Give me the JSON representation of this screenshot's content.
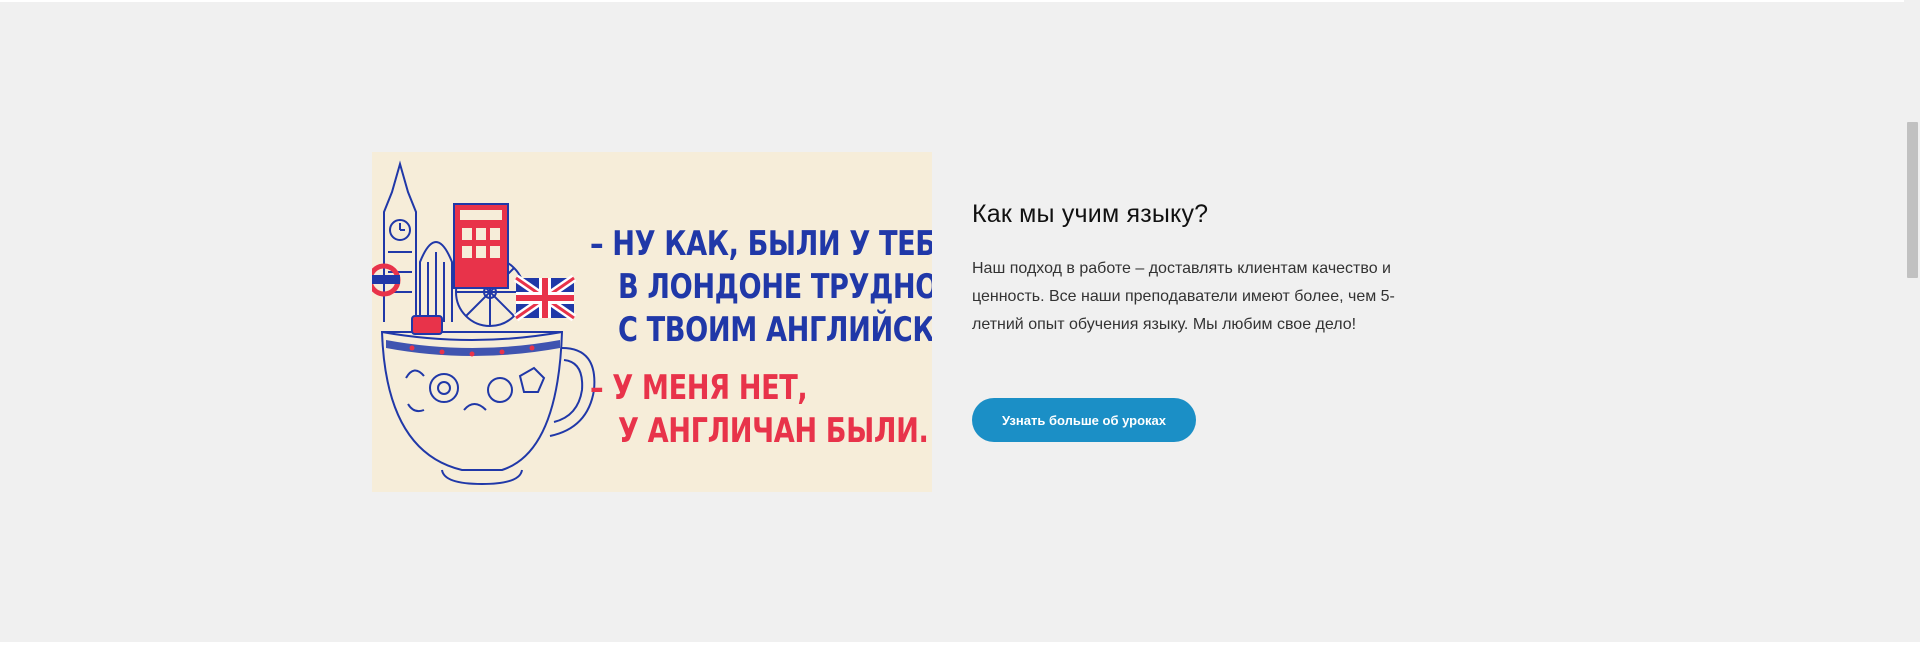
{
  "promo": {
    "image_text": {
      "line1": "– НУ КАК, БЫЛИ У ТЕБЯ",
      "line2": "В ЛОНДОНЕ ТРУДНОСТИ",
      "line3": "С ТВОИМ АНГЛИЙСКИМ?",
      "line4": "– У МЕНЯ НЕТ,",
      "line5": "У АНГЛИЧАН БЫЛИ."
    },
    "heading": "Как мы учим языку?",
    "body": "Наш подход в работе – доставлять клиентам качество и ценность. Все наши преподаватели имеют более, чем 5-летний опыт обучения языку. Мы любим свое дело!",
    "button_label": "Узнать больше об уроках"
  },
  "colors": {
    "background": "#f0f0f0",
    "button": "#1b8fc6",
    "image_background": "#f6edd9",
    "image_text_blue": "#2038a8",
    "image_text_red": "#e8334a"
  },
  "icons": [
    "teacup-london-illustration",
    "union-jack-flag-icon"
  ]
}
